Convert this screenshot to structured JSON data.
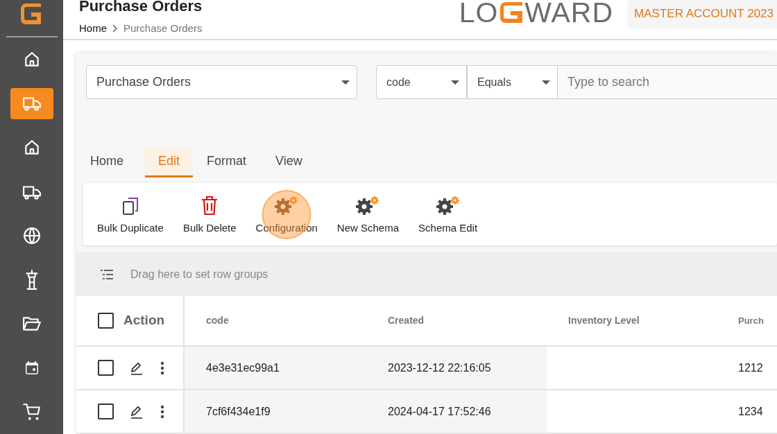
{
  "page": {
    "title": "Purchase Orders",
    "breadcrumb": [
      {
        "label": "Home"
      },
      {
        "label": "Purchase Orders"
      }
    ]
  },
  "logo": {
    "left": "LO",
    "right": "WARD"
  },
  "account": "MASTER ACCOUNT 2023",
  "sidebar": {
    "items": [
      {
        "selected": false
      },
      {
        "selected": true
      },
      {
        "selected": false
      },
      {
        "selected": false
      },
      {
        "selected": false
      },
      {
        "selected": false
      },
      {
        "selected": false
      },
      {
        "selected": false
      },
      {
        "selected": false
      }
    ]
  },
  "filters": {
    "view": "Purchase Orders",
    "field": "code",
    "operator": "Equals",
    "search": {
      "placeholder": "Type to search"
    }
  },
  "tabs": [
    {
      "label": "Home",
      "selected": false
    },
    {
      "label": "Edit",
      "selected": true
    },
    {
      "label": "Format",
      "selected": false
    },
    {
      "label": "View",
      "selected": false
    }
  ],
  "tools": [
    {
      "label": "Bulk Duplicate",
      "kind": "duplicate",
      "highlighted": false
    },
    {
      "label": "Bulk Delete",
      "kind": "delete",
      "highlighted": false
    },
    {
      "label": "Configuration",
      "kind": "gear",
      "highlighted": true
    },
    {
      "label": "New Schema",
      "kind": "gear",
      "highlighted": false
    },
    {
      "label": "Schema Edit",
      "kind": "gear",
      "highlighted": false
    }
  ],
  "row_groups": {
    "hint": "Drag here to set row groups"
  },
  "table": {
    "action_header": "Action",
    "all_checked": false,
    "columns": [
      "code",
      "Created",
      "Inventory Level",
      "Purch"
    ],
    "rows": [
      {
        "checked": false,
        "cells": [
          "4e3e31ec99a1",
          "2023-12-12 22:16:05",
          "",
          "1212"
        ]
      },
      {
        "checked": false,
        "cells": [
          "7cf6f434e1f9",
          "2024-04-17 17:52:46",
          "",
          "1234"
        ]
      }
    ]
  }
}
